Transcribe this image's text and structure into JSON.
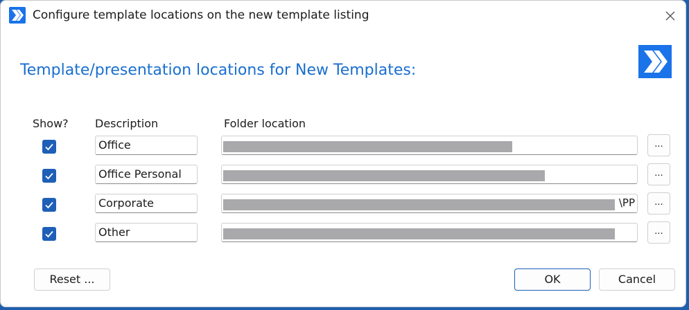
{
  "window": {
    "title": "Configure template locations on the new template listing"
  },
  "heading": "Template/presentation locations for New Templates:",
  "columns": {
    "show": "Show?",
    "description": "Description",
    "folder": "Folder location"
  },
  "rows": [
    {
      "show": true,
      "description": "Office",
      "folder_visible_text": "",
      "redacted_fraction": 0.7
    },
    {
      "show": true,
      "description": "Office Personal",
      "folder_visible_text": "",
      "redacted_fraction": 0.78
    },
    {
      "show": true,
      "description": "Corporate",
      "folder_visible_text": "\\PP",
      "redacted_fraction": 0.95
    },
    {
      "show": true,
      "description": "Other",
      "folder_visible_text": "",
      "redacted_fraction": 0.95
    }
  ],
  "browse_label": "...",
  "buttons": {
    "reset": "Reset ...",
    "ok": "OK",
    "cancel": "Cancel"
  },
  "colors": {
    "accent": "#1a73e8",
    "heading": "#1a6fcf",
    "checkbox": "#1e5fb8"
  },
  "icons": {
    "app": "chevrons-right-icon",
    "logo": "chevrons-right-icon",
    "close": "close-icon",
    "check": "checkmark-icon"
  }
}
